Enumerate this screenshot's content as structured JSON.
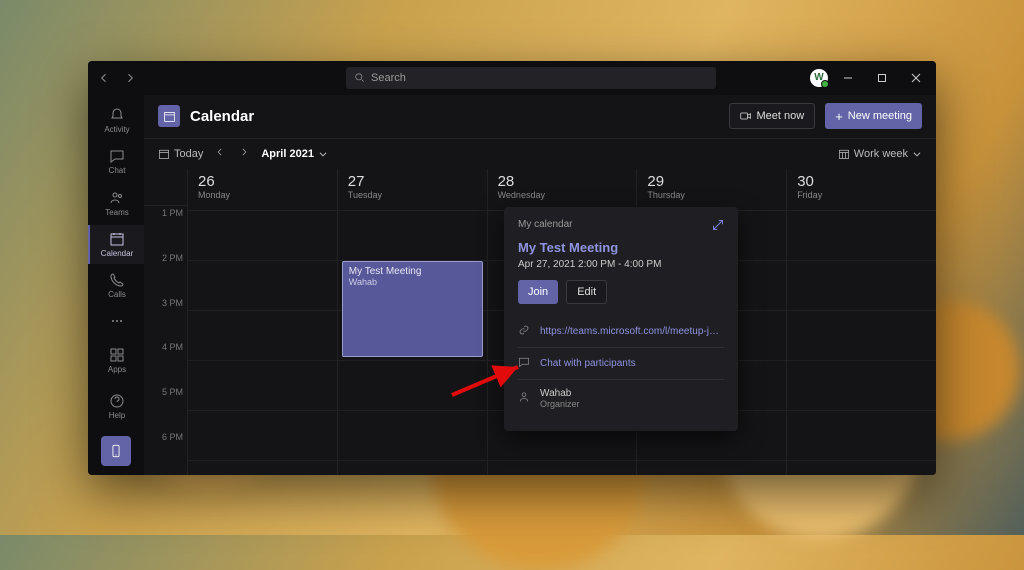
{
  "titlebar": {
    "search_placeholder": "Search",
    "avatar_initial": "W"
  },
  "rail": {
    "items": [
      {
        "key": "activity",
        "label": "Activity"
      },
      {
        "key": "chat",
        "label": "Chat"
      },
      {
        "key": "teams",
        "label": "Teams"
      },
      {
        "key": "calendar",
        "label": "Calendar"
      },
      {
        "key": "calls",
        "label": "Calls"
      },
      {
        "key": "more",
        "label": ""
      }
    ],
    "bottom": [
      {
        "key": "apps",
        "label": "Apps"
      },
      {
        "key": "help",
        "label": "Help"
      }
    ]
  },
  "page": {
    "title": "Calendar",
    "meet_now": "Meet now",
    "new_meeting": "New meeting"
  },
  "toolbar": {
    "today": "Today",
    "month": "April 2021",
    "view": "Work week"
  },
  "days": [
    {
      "num": "26",
      "label": "Monday"
    },
    {
      "num": "27",
      "label": "Tuesday"
    },
    {
      "num": "28",
      "label": "Wednesday"
    },
    {
      "num": "29",
      "label": "Thursday"
    },
    {
      "num": "30",
      "label": "Friday"
    }
  ],
  "hours": [
    "1 PM",
    "2 PM",
    "3 PM",
    "4 PM",
    "5 PM",
    "6 PM"
  ],
  "event": {
    "title": "My Test Meeting",
    "organizer": "Wahab"
  },
  "popover": {
    "source": "My calendar",
    "title": "My Test Meeting",
    "time": "Apr 27, 2021 2:00 PM - 4:00 PM",
    "join": "Join",
    "edit": "Edit",
    "link": "https://teams.microsoft.com/l/meetup-join...",
    "chat": "Chat with participants",
    "organizer_name": "Wahab",
    "organizer_role": "Organizer"
  }
}
